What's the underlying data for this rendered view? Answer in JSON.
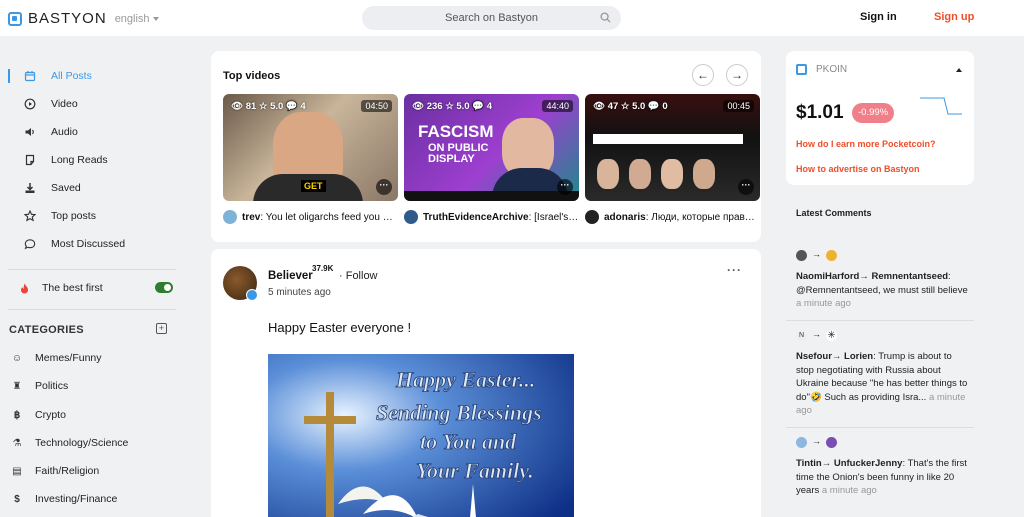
{
  "header": {
    "brand": "BASTYON",
    "language": "english",
    "search_placeholder": "Search on Bastyon",
    "sign_in": "Sign in",
    "sign_up": "Sign up"
  },
  "sidebar": {
    "nav": [
      {
        "label": "All Posts",
        "icon": "calendar-icon",
        "active": true
      },
      {
        "label": "Video",
        "icon": "play-circle-icon"
      },
      {
        "label": "Audio",
        "icon": "speaker-icon"
      },
      {
        "label": "Long Reads",
        "icon": "document-icon"
      },
      {
        "label": "Saved",
        "icon": "download-icon"
      },
      {
        "label": "Top posts",
        "icon": "star-icon"
      },
      {
        "label": "Most Discussed",
        "icon": "comment-icon"
      }
    ],
    "best_first": "The best first",
    "categories_title": "CATEGORIES",
    "categories": [
      {
        "label": "Memes/Funny",
        "icon": "smile-icon"
      },
      {
        "label": "Politics",
        "icon": "podium-icon"
      },
      {
        "label": "Crypto",
        "icon": "bitcoin-icon"
      },
      {
        "label": "Technology/Science",
        "icon": "microscope-icon"
      },
      {
        "label": "Faith/Religion",
        "icon": "book-icon"
      },
      {
        "label": "Investing/Finance",
        "icon": "dollar-icon"
      }
    ]
  },
  "top_videos": {
    "title": "Top videos",
    "videos": [
      {
        "views": "81",
        "rating": "5.0",
        "comments": "4",
        "duration": "04:50",
        "author": "trev",
        "text": "You let oligarchs feed you propaganda"
      },
      {
        "views": "236",
        "rating": "5.0",
        "comments": "4",
        "duration": "44:40",
        "author": "TruthEvidenceArchive",
        "text": "[Israel's true history]"
      },
      {
        "views": "47",
        "rating": "5.0",
        "comments": "0",
        "duration": "00:45",
        "author": "adonaris",
        "text": "Люди, которые правят Израилем"
      }
    ]
  },
  "post": {
    "author": "Believer",
    "reputation": "37.9K",
    "follow": "· Follow",
    "time": "5 minutes ago",
    "text": "Happy Easter everyone !",
    "image_lines": [
      "Happy Easter...",
      "Sending Blessings",
      "to You and",
      "Your Family."
    ]
  },
  "pkoin": {
    "label": "PKOIN",
    "price": "$1.01",
    "change": "-0.99%",
    "link_earn": "How do I earn more Pocketcoin?",
    "link_advertise": "How to advertise on Bastyon"
  },
  "latest_comments": {
    "title": "Latest Comments",
    "items": [
      {
        "from": "NaomiHarford",
        "to": "Remnentantseed",
        "text": "@Remnentantseed, we must still believe",
        "ago": "a minute ago"
      },
      {
        "from": "Nsefour",
        "to": "Lorien",
        "text": "Trump is about to stop negotiating with Russia about Ukraine because \"he has better things to do\"🤣 Such as providing Isra...",
        "ago": "a minute ago"
      },
      {
        "from": "Tintin",
        "to": "UnfuckerJenny",
        "text": "That's the first time the Onion's been funny in like 20 years",
        "ago": "a minute ago"
      }
    ]
  },
  "colors": {
    "accent": "#3b98e5",
    "signup": "#f04d29",
    "negative": "#f07f8a",
    "toggle_on": "#2e7d32"
  }
}
